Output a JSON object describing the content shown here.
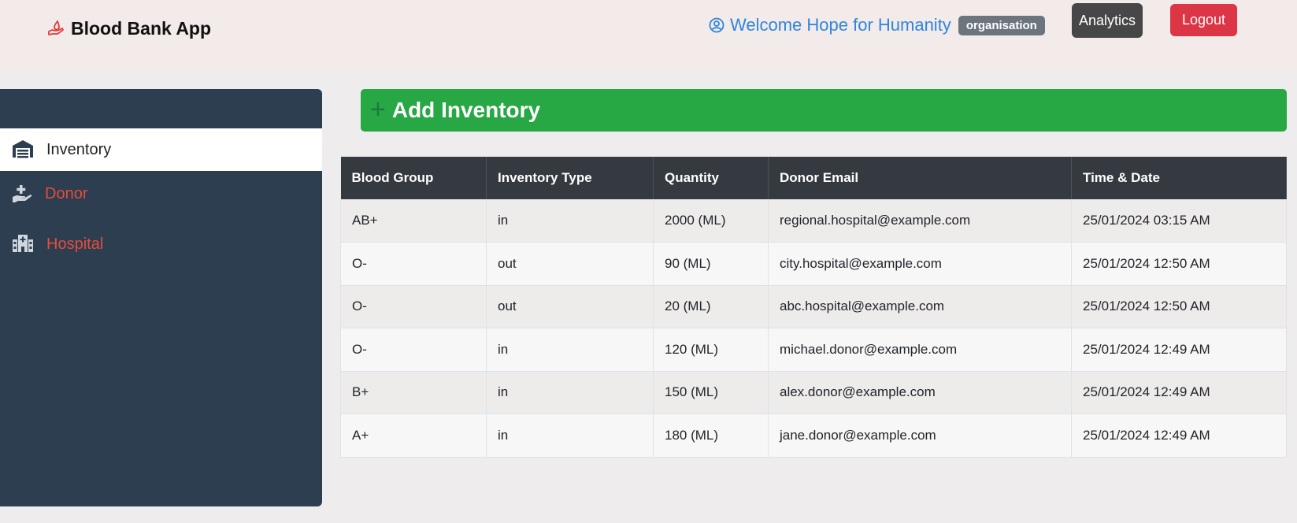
{
  "app": {
    "title": "Blood Bank App"
  },
  "header": {
    "welcome_text": "Welcome Hope for Humanity",
    "role_badge": "organisation",
    "analytics_label": "Analytics",
    "logout_label": "Logout"
  },
  "sidebar": {
    "items": [
      {
        "label": "Inventory",
        "icon": "warehouse-icon",
        "active": true
      },
      {
        "label": "Donor",
        "icon": "hand-holding-medical-icon",
        "active": false
      },
      {
        "label": "Hospital",
        "icon": "hospital-icon",
        "active": false
      }
    ]
  },
  "main": {
    "add_inventory_label": "Add Inventory",
    "table": {
      "headers": [
        "Blood Group",
        "Inventory Type",
        "Quantity",
        "Donor Email",
        "Time & Date"
      ],
      "rows": [
        [
          "AB+",
          "in",
          "2000 (ML)",
          "regional.hospital@example.com",
          "25/01/2024 03:15 AM"
        ],
        [
          "O-",
          "out",
          "90 (ML)",
          "city.hospital@example.com",
          "25/01/2024 12:50 AM"
        ],
        [
          "O-",
          "out",
          "20 (ML)",
          "abc.hospital@example.com",
          "25/01/2024 12:50 AM"
        ],
        [
          "O-",
          "in",
          "120 (ML)",
          "michael.donor@example.com",
          "25/01/2024 12:49 AM"
        ],
        [
          "B+",
          "in",
          "150 (ML)",
          "alex.donor@example.com",
          "25/01/2024 12:49 AM"
        ],
        [
          "A+",
          "in",
          "180 (ML)",
          "jane.donor@example.com",
          "25/01/2024 12:49 AM"
        ]
      ]
    }
  },
  "colors": {
    "accent_red": "#dc3545",
    "sidebar_bg": "#2c3e50",
    "add_button_green": "#28a745",
    "welcome_blue": "#2e86de"
  }
}
